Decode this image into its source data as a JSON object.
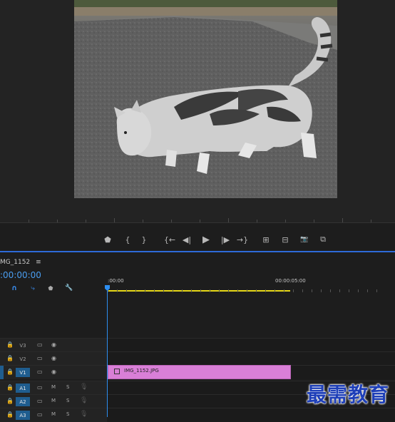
{
  "monitor": {
    "transport_buttons": [
      {
        "icon": "marker-icon",
        "glyph": "⬟"
      },
      {
        "icon": "mark-in-icon",
        "glyph": "{"
      },
      {
        "icon": "mark-out-icon",
        "glyph": "}"
      },
      {
        "icon": "go-to-in-icon",
        "glyph": "{←"
      },
      {
        "icon": "step-back-icon",
        "glyph": "◀|"
      },
      {
        "icon": "play-icon",
        "glyph": "▶"
      },
      {
        "icon": "step-forward-icon",
        "glyph": "|▶"
      },
      {
        "icon": "go-to-out-icon",
        "glyph": "→}"
      },
      {
        "icon": "lift-icon",
        "glyph": "⊞"
      },
      {
        "icon": "extract-icon",
        "glyph": "⊟"
      },
      {
        "icon": "camera-icon",
        "glyph": "📷"
      },
      {
        "icon": "compare-icon",
        "glyph": "⧉"
      }
    ]
  },
  "timeline": {
    "sequence_name": "MG_1152",
    "menu_glyph": "≡",
    "timecode": ":00:00:00",
    "ruler": {
      "start_label": ":00:00",
      "mark_label": "00:00:05:00"
    },
    "tools": [
      {
        "icon": "snap-icon",
        "glyph": "∩"
      },
      {
        "icon": "linked-selection-icon",
        "glyph": "⤷"
      },
      {
        "icon": "add-marker-icon",
        "glyph": "⬟"
      },
      {
        "icon": "wrench-icon",
        "glyph": "🔧"
      }
    ],
    "video_tracks": [
      {
        "name": "V3"
      },
      {
        "name": "V2"
      },
      {
        "name": "V1",
        "selected": true
      }
    ],
    "audio_tracks": [
      {
        "name": "A1",
        "mute": "M",
        "solo": "S"
      },
      {
        "name": "A2",
        "mute": "M",
        "solo": "S"
      },
      {
        "name": "A3",
        "mute": "M",
        "solo": "S"
      }
    ],
    "clip": {
      "label": "IMG_1152.JPG",
      "color": "#d97fd7"
    }
  },
  "watermark": "最需教育",
  "colors": {
    "accent": "#2d8ef0",
    "work_area": "#e6d817",
    "selected_track": "#1f5d8f"
  }
}
